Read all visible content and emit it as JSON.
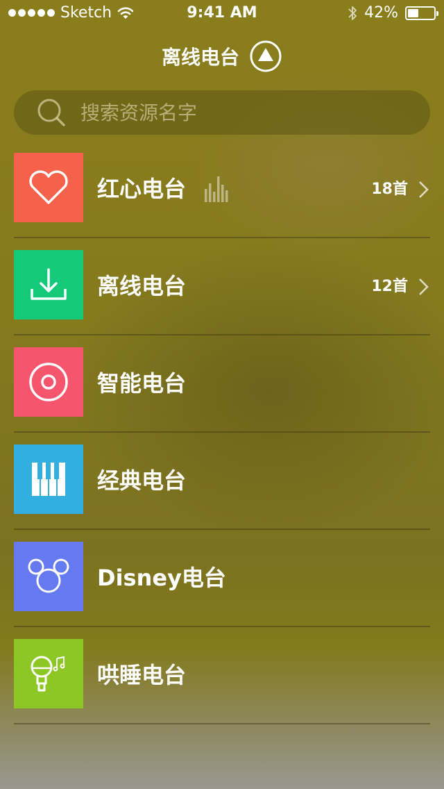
{
  "status_bar": {
    "carrier": "Sketch",
    "time": "9:41 AM",
    "battery": "42%",
    "battery_level": 0.42
  },
  "nav": {
    "title": "离线电台",
    "icon": "up-triangle-circle-icon"
  },
  "search": {
    "placeholder": "搜索资源名字"
  },
  "stations": [
    {
      "label": "红心电台",
      "count": "18首",
      "color": "#f5614a",
      "icon": "heart-icon",
      "playing": true
    },
    {
      "label": "离线电台",
      "count": "12首",
      "color": "#14c97a",
      "icon": "download-icon",
      "playing": false
    },
    {
      "label": "智能电台",
      "count": "",
      "color": "#f5566e",
      "icon": "disc-icon",
      "playing": false
    },
    {
      "label": "经典电台",
      "count": "",
      "color": "#33aee0",
      "icon": "piano-icon",
      "playing": false
    },
    {
      "label": "Disney电台",
      "count": "",
      "color": "#6579f0",
      "icon": "mickey-icon",
      "playing": false
    },
    {
      "label": "哄睡电台",
      "count": "",
      "color": "#8dc725",
      "icon": "microphone-music-icon",
      "playing": false
    }
  ]
}
